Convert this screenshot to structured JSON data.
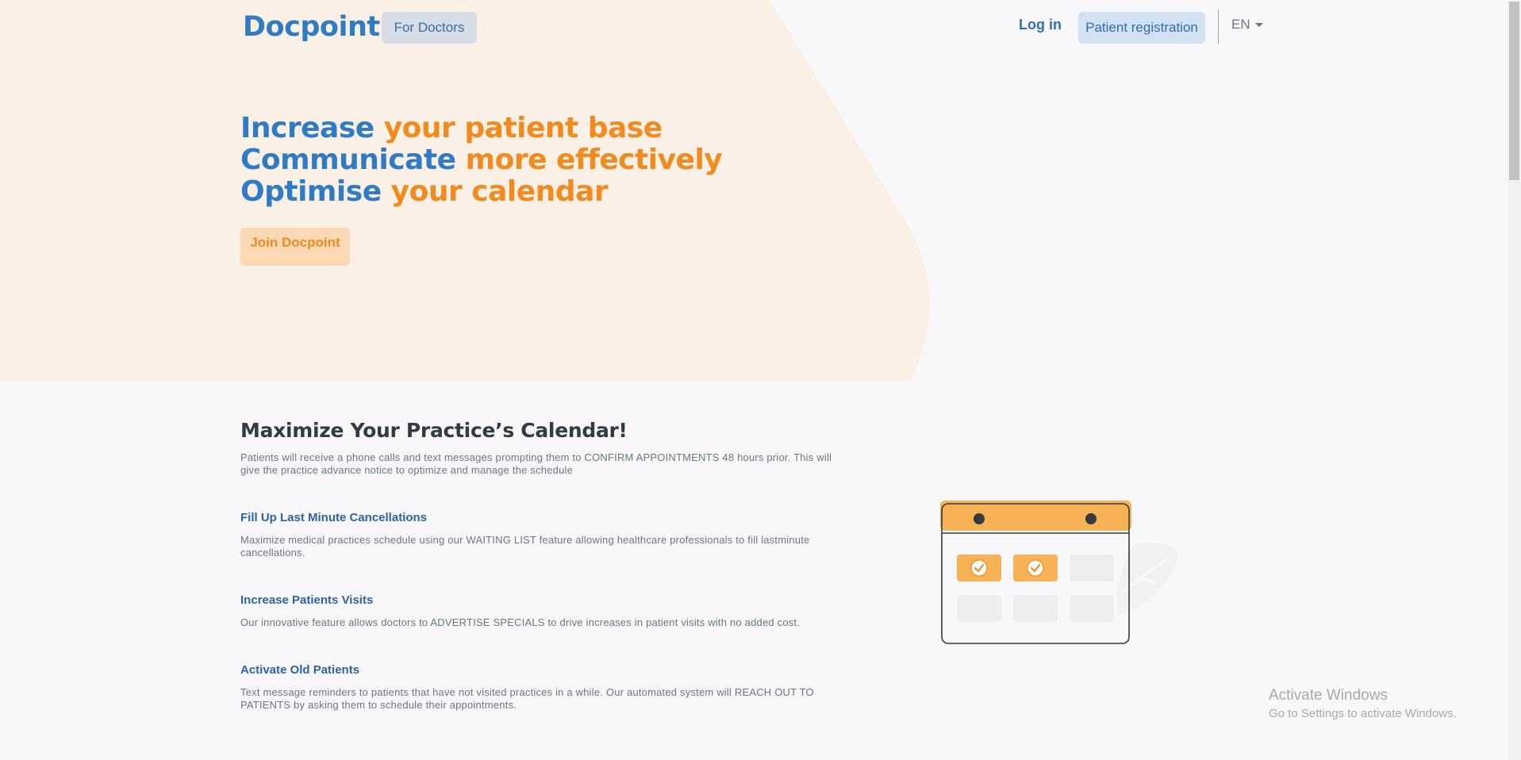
{
  "colors": {
    "brand_blue": "#2f7bc4",
    "brand_orange": "#f28a1e",
    "hero_bg": "#fbf0e6"
  },
  "header": {
    "logo_text": "Docpoint",
    "logo_dot": ".",
    "for_doctors": "For Doctors",
    "login": "Log in",
    "patient_registration": "Patient registration",
    "language": "EN",
    "language_icon": "chevron-down-icon"
  },
  "hero": {
    "line1_blue": "Increase",
    "line1_orange": "your patient base",
    "line2_blue": "Communicate",
    "line2_orange": "more effectively",
    "line3_blue": "Optimise",
    "line3_orange": "your calendar",
    "join_button": "Join Docpoint"
  },
  "section": {
    "title": "Maximize Your Practice’s Calendar!",
    "description": "Patients will receive a phone calls and text messages prompting them to CONFIRM APPOINTMENTS 48 hours prior. This will give the practice advance notice to optimize and manage the schedule"
  },
  "features": [
    {
      "title": "Fill Up Last Minute Cancellations",
      "description": "Maximize medical practices schedule using our WAITING LIST feature allowing healthcare professionals to fill lastminute cancellations."
    },
    {
      "title": "Increase Patients Visits",
      "description": "Our innovative feature allows doctors to ADVERTISE SPECIALS to drive increases in patient visits with no added cost."
    },
    {
      "title": "Activate Old Patients",
      "description": "Text message reminders to patients that have not visited practices in a while. Our automated system will REACH OUT TO PATIENTS by asking them to schedule their appointments."
    }
  ],
  "illustration": {
    "icon": "calendar-icon"
  },
  "watermark": {
    "line1": "Activate Windows",
    "line2": "Go to Settings to activate Windows."
  }
}
